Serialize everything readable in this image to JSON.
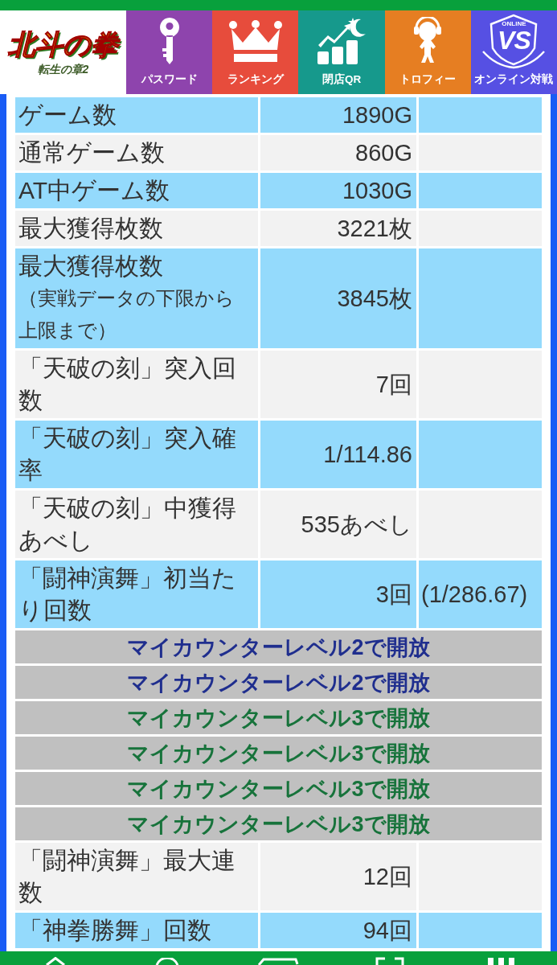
{
  "logo": {
    "title": "北斗の拳",
    "subtitle": "転生の章2"
  },
  "nav": [
    {
      "label": "パスワード",
      "color": "#8e44ad"
    },
    {
      "label": "ランキング",
      "color": "#e74c3c"
    },
    {
      "label": "閉店QR",
      "color": "#16998c"
    },
    {
      "label": "トロフィー",
      "color": "#e67e22"
    },
    {
      "label": "オンライン対戦",
      "color": "#5650e3",
      "emblem_caption": "ONLINE",
      "emblem_text": "VS"
    }
  ],
  "table": {
    "rows": [
      {
        "kind": "data",
        "label": "ゲーム数",
        "value": "1890G"
      },
      {
        "kind": "data",
        "label": "通常ゲーム数",
        "value": "860G"
      },
      {
        "kind": "data",
        "label": "AT中ゲーム数",
        "value": "1030G"
      },
      {
        "kind": "data",
        "label": "最大獲得枚数",
        "value": "3221枚"
      },
      {
        "kind": "data",
        "label": "最大獲得枚数",
        "note": "（実戦データの下限から上限まで）",
        "value": "3845枚"
      },
      {
        "kind": "data",
        "label": "「天破の刻」突入回数",
        "value": "7回"
      },
      {
        "kind": "data",
        "label": "「天破の刻」突入確率",
        "value": "1/114.86"
      },
      {
        "kind": "data",
        "label": "「天破の刻」中獲得あべし",
        "value": "535あべし"
      },
      {
        "kind": "data",
        "label": "「闘神演舞」初当たり回数",
        "value": "3回",
        "extra": "(1/286.67)"
      },
      {
        "kind": "locked",
        "text": "マイカウンターレベル2で開放",
        "color": "#1f2e8e"
      },
      {
        "kind": "locked",
        "text": "マイカウンターレベル2で開放",
        "color": "#1f2e8e"
      },
      {
        "kind": "locked",
        "text": "マイカウンターレベル3で開放",
        "color": "#17733b"
      },
      {
        "kind": "locked",
        "text": "マイカウンターレベル3で開放",
        "color": "#17733b"
      },
      {
        "kind": "locked",
        "text": "マイカウンターレベル3で開放",
        "color": "#17733b"
      },
      {
        "kind": "locked",
        "text": "マイカウンターレベル3で開放",
        "color": "#17733b"
      },
      {
        "kind": "data",
        "label": "「闘神演舞」最大連数",
        "value": "12回"
      },
      {
        "kind": "data",
        "label": "「神拳勝舞」回数",
        "value": "94回"
      }
    ]
  }
}
